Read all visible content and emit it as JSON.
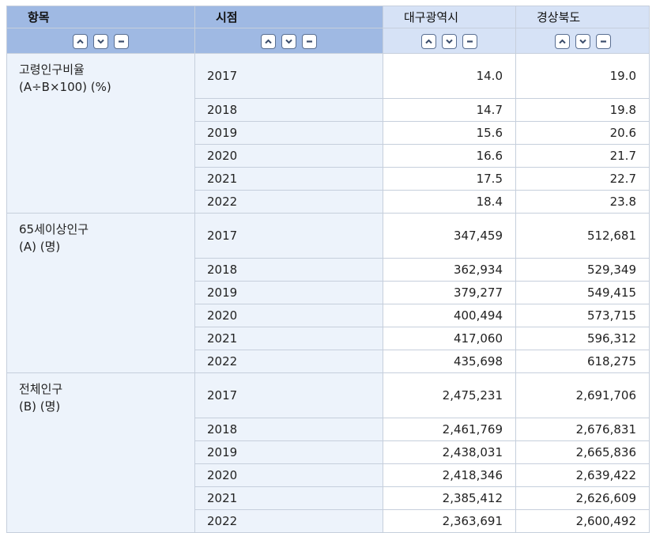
{
  "header": {
    "item": "항목",
    "period": "시점",
    "regions": [
      "대구광역시",
      "경상북도"
    ]
  },
  "controls": {
    "icons": [
      "chevron-up-icon",
      "chevron-down-icon",
      "minus-icon"
    ]
  },
  "groups": [
    {
      "label_line1": "고령인구비율",
      "label_line2": "(A÷B×100) (%)",
      "rows": [
        {
          "year": "2017",
          "v1": "14.0",
          "v2": "19.0"
        },
        {
          "year": "2018",
          "v1": "14.7",
          "v2": "19.8"
        },
        {
          "year": "2019",
          "v1": "15.6",
          "v2": "20.6"
        },
        {
          "year": "2020",
          "v1": "16.6",
          "v2": "21.7"
        },
        {
          "year": "2021",
          "v1": "17.5",
          "v2": "22.7"
        },
        {
          "year": "2022",
          "v1": "18.4",
          "v2": "23.8"
        }
      ]
    },
    {
      "label_line1": "65세이상인구",
      "label_line2": "(A) (명)",
      "rows": [
        {
          "year": "2017",
          "v1": "347,459",
          "v2": "512,681"
        },
        {
          "year": "2018",
          "v1": "362,934",
          "v2": "529,349"
        },
        {
          "year": "2019",
          "v1": "379,277",
          "v2": "549,415"
        },
        {
          "year": "2020",
          "v1": "400,494",
          "v2": "573,715"
        },
        {
          "year": "2021",
          "v1": "417,060",
          "v2": "596,312"
        },
        {
          "year": "2022",
          "v1": "435,698",
          "v2": "618,275"
        }
      ]
    },
    {
      "label_line1": "전체인구",
      "label_line2": "(B) (명)",
      "rows": [
        {
          "year": "2017",
          "v1": "2,475,231",
          "v2": "2,691,706"
        },
        {
          "year": "2018",
          "v1": "2,461,769",
          "v2": "2,676,831"
        },
        {
          "year": "2019",
          "v1": "2,438,031",
          "v2": "2,665,836"
        },
        {
          "year": "2020",
          "v1": "2,418,346",
          "v2": "2,639,422"
        },
        {
          "year": "2021",
          "v1": "2,385,412",
          "v2": "2,626,609"
        },
        {
          "year": "2022",
          "v1": "2,363,691",
          "v2": "2,600,492"
        }
      ]
    }
  ],
  "colors": {
    "dim_header": "#9fb9e3",
    "col_header": "#d6e2f6",
    "label_bg": "#edf3fb",
    "border": "#c6cfdc"
  }
}
